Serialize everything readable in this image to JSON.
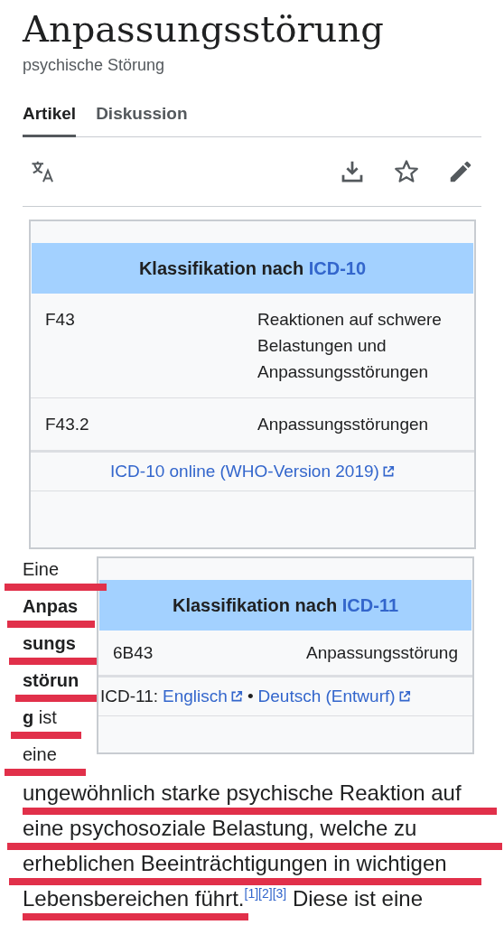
{
  "title": "Anpassungsstörung",
  "subtitle": "psychische Störung",
  "tabs": [
    {
      "label": "Artikel",
      "selected": true
    },
    {
      "label": "Diskussion",
      "selected": false
    }
  ],
  "infoboxes": [
    {
      "heading": "Klassifikation nach",
      "heading_link": "ICD-10",
      "rows": [
        {
          "code": "F43",
          "text": "Reaktionen auf schwere Belastungen und Anpassungsstörungen"
        },
        {
          "code": "F43.2",
          "text": "Anpassungsstörungen"
        }
      ],
      "footer": {
        "links": [
          "ICD-10 online (WHO-Version 2019)"
        ]
      }
    },
    {
      "heading": "Klassifikation nach",
      "heading_link": "ICD-11",
      "rows": [
        {
          "code": "6B43",
          "text": "Anpassungsstörung"
        }
      ],
      "footer": {
        "prefix": "ICD-11:",
        "separator": "•",
        "links": [
          "Englisch",
          "Deutsch (Entwurf)"
        ]
      }
    }
  ],
  "paragraph": {
    "lines_beside": [
      "Eine",
      "**Anpas**",
      "**sungs**",
      "**störun**",
      "**g** ist",
      "eine"
    ],
    "lines": [
      "ungewöhnlich starke psychische Reaktion auf",
      "eine psychosoziale Belastung, welche zu",
      "erheblichen Beeinträchtigungen in wichtigen",
      "Lebensbereichen führt."
    ],
    "refs": [
      "[1]",
      "[2]",
      "[3]"
    ],
    "tail": "Diese ist eine"
  }
}
